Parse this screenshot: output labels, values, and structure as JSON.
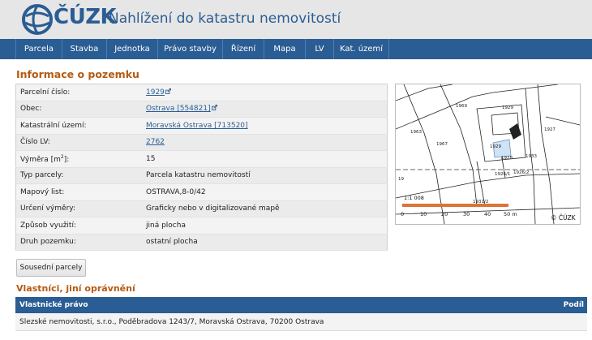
{
  "header": {
    "logo_text": "ČÚZK",
    "title": "Nahlížení do katastru nemovitostí"
  },
  "nav": {
    "items": [
      {
        "label": "Parcela"
      },
      {
        "label": "Stavba"
      },
      {
        "label": "Jednotka"
      },
      {
        "label": "Právo stavby"
      },
      {
        "label": "Řízení"
      },
      {
        "label": "Mapa"
      },
      {
        "label": "LV"
      },
      {
        "label": "Kat. území"
      }
    ]
  },
  "section_title": "Informace o pozemku",
  "info": {
    "rows": [
      {
        "label": "Parcelní číslo:",
        "value": "1929",
        "link": true
      },
      {
        "label": "Obec:",
        "value": "Ostrava [554821]",
        "link": true
      },
      {
        "label": "Katastrální území:",
        "value": "Moravská Ostrava [713520]",
        "link": true
      },
      {
        "label": "Číslo LV:",
        "value": "2762",
        "link": true
      },
      {
        "label_prefix": "Výměra [m",
        "label_sup": "2",
        "label_suffix": "]:",
        "value": "15"
      },
      {
        "label": "Typ parcely:",
        "value": "Parcela katastru nemovitostí"
      },
      {
        "label": "Mapový list:",
        "value": "OSTRAVA,8-0/42"
      },
      {
        "label": "Určení výměry:",
        "value": "Graficky nebo v digitalizované mapě"
      },
      {
        "label": "Způsob využití:",
        "value": "jiná plocha"
      },
      {
        "label": "Druh pozemku:",
        "value": "ostatní plocha"
      }
    ]
  },
  "map": {
    "scale_label": "1:1 008",
    "scale_ticks": [
      "0",
      "10",
      "20",
      "30",
      "40",
      "50 m"
    ],
    "copyright": "© ČÚZK",
    "parcel_labels": [
      "1929",
      "1929",
      "1928",
      "1927",
      "1933",
      "1926/1",
      "1926/2",
      "1931/2",
      "1969",
      "1967",
      "1963",
      "19"
    ]
  },
  "neighbors_button": "Sousední parcely",
  "owners": {
    "title": "Vlastníci, jiní oprávnění",
    "col_right": "Vlastnické právo",
    "col_share": "Podíl",
    "rows": [
      {
        "name": "Slezské nemovitosti, s.r.o., Poděbradova 1243/7, Moravská Ostrava, 70200 Ostrava"
      }
    ]
  },
  "colors": {
    "brand_blue": "#2a5d93",
    "section_orange": "#b55a10"
  }
}
